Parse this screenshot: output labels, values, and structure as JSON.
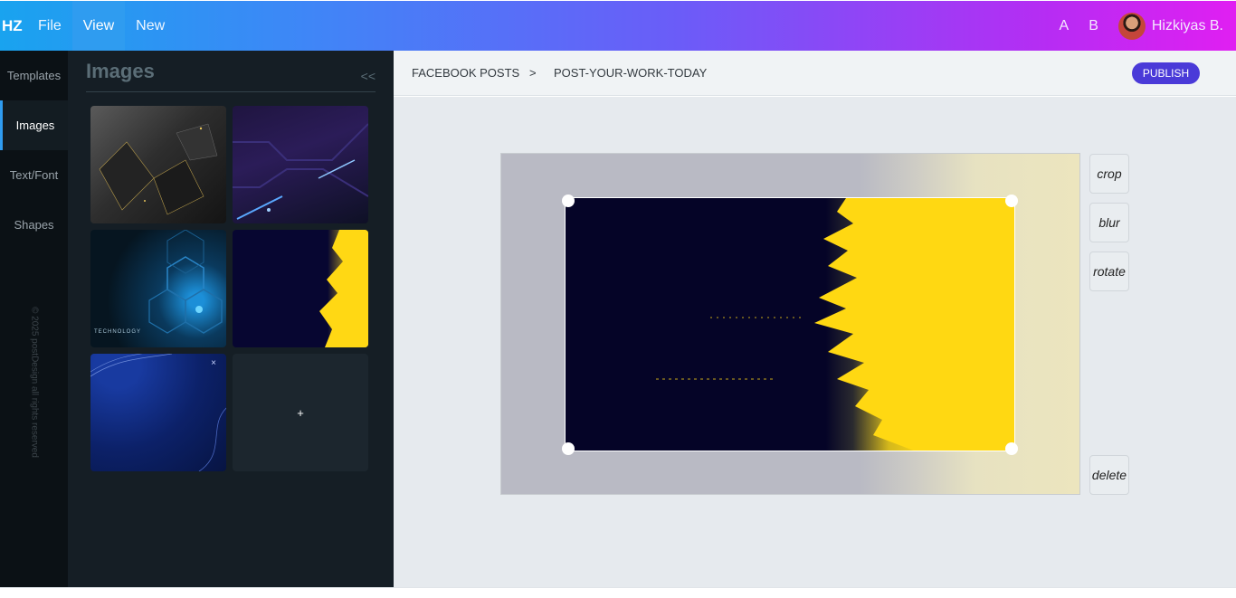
{
  "app": {
    "logo": "HZ"
  },
  "menu": {
    "file": "File",
    "view": "View",
    "new": "New"
  },
  "header_right": {
    "a": "A",
    "b": "B",
    "user_name": "Hizkiyas B."
  },
  "rail": {
    "items": [
      {
        "label": "Templates"
      },
      {
        "label": "Images"
      },
      {
        "label": "Text/Font"
      },
      {
        "label": "Shapes"
      }
    ],
    "active": "Images",
    "copyright": "© 2025 postDesign all rights reserved"
  },
  "panel": {
    "title": "Images",
    "collapse": "<<",
    "thumbs": [
      {
        "icon": "dark-polygon-image"
      },
      {
        "icon": "purple-neon-image"
      },
      {
        "icon": "hexagon-technology-image",
        "caption": "TECHNOLOGY"
      },
      {
        "icon": "navy-yellow-brush-image"
      },
      {
        "icon": "blue-wave-image",
        "close": "×"
      },
      {
        "icon": "plus-icon",
        "add": "+"
      }
    ]
  },
  "breadcrumb": {
    "parent": "FACEBOOK POSTS",
    "separator": ">",
    "current": "POST-YOUR-WORK-TODAY"
  },
  "actions": {
    "publish": "PUBLISH"
  },
  "tools": {
    "crop": "crop",
    "blur": "blur",
    "rotate": "rotate",
    "delete": "delete"
  },
  "colors": {
    "accent": "#4a3ad8",
    "header_gradient_start": "#19a3ef",
    "header_gradient_end": "#e01ff2",
    "navy": "#050427",
    "yellow": "#ffd812"
  }
}
